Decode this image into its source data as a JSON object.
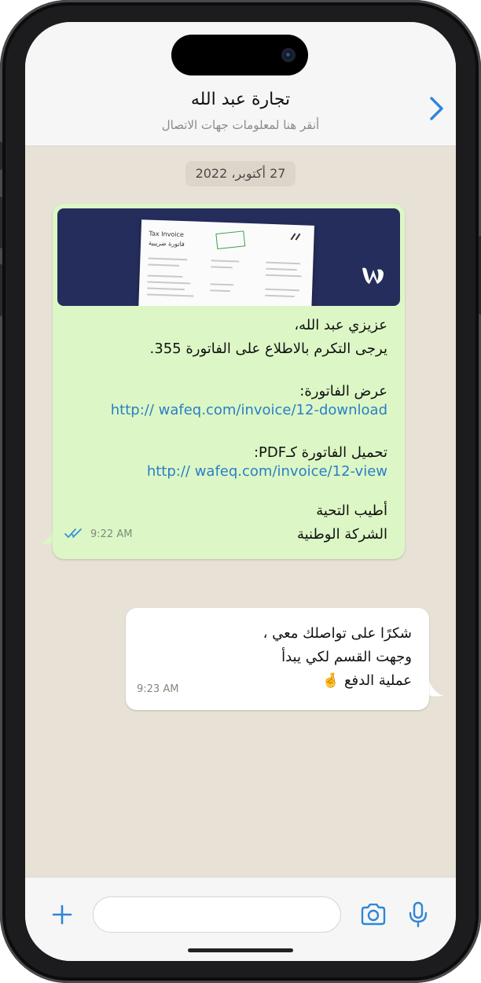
{
  "header": {
    "contact_name": "تجارة عبد الله",
    "subtitle": "أنقر هنا لمعلومات جهات الاتصال"
  },
  "chat": {
    "date_label": "27 أكتوبر، 2022",
    "incoming": {
      "preview": {
        "doc_title_en": "Tax Invoice",
        "doc_title_ar": "فاتورة ضريبية"
      },
      "greeting": "عزيزي عبد الله،",
      "line_request": "يرجى التكرم بالاطلاع على الفاتورة 355.",
      "view_label": "عرض الفاتورة:",
      "view_link": "http:// wafeq.com/invoice/12-download",
      "download_label": "تحميل الفاتورة كـPDF:",
      "download_link": "http:// wafeq.com/invoice/12-view",
      "closing": "أطيب التحية",
      "signature": "الشركة الوطنية",
      "time": "9:22 AM",
      "status": "read"
    },
    "outgoing": {
      "line1": "شكرًا على تواصلك معي ،",
      "line2": "وجهت القسم لكي يبدأ",
      "line3": "عملية الدفع 🤞",
      "time": "9:23 AM"
    }
  },
  "composer": {
    "placeholder": ""
  },
  "icons": {
    "back": "chevron-right-icon",
    "attach": "plus-icon",
    "camera": "camera-icon",
    "voice": "microphone-icon",
    "read_receipt": "double-check-icon"
  },
  "colors": {
    "accent": "#2f86d6",
    "incoming_bubble": "#dcf7c5",
    "outgoing_bubble": "#ffffff",
    "chat_background": "#e7e1d6",
    "link": "#2a7ec7"
  }
}
